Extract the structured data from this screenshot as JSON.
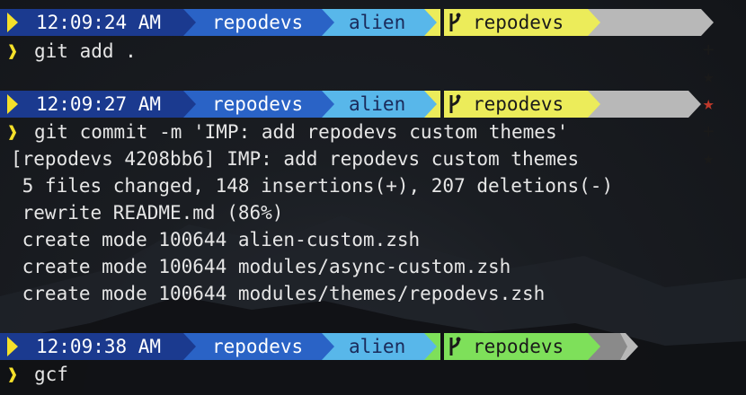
{
  "colors": {
    "time_bg": "#1b3a8f",
    "time_fg": "#ffffff",
    "user_bg": "#2a63c6",
    "user_fg": "#ffffff",
    "dir_bg": "#58b7ea",
    "dir_fg": "#1a2a5a",
    "branch_bg": "#ecec5a",
    "branch_bg_clean": "#7ee05a",
    "branch_fg": "#1a1a1a",
    "status_bg": "#b8b8b8",
    "status_fg": "#1a1a1a",
    "stash_star": "#c0392b",
    "prompt_arrow": "#f5e02a"
  },
  "prompts": [
    {
      "time": "12:09:24 AM",
      "user": "repodevs",
      "dir": "alien",
      "branch_icon": "git-branch-icon",
      "branch": "repodevs",
      "status": [
        "+",
        "★",
        "★"
      ],
      "command": "git add ."
    },
    {
      "time": "12:09:27 AM",
      "user": "repodevs",
      "dir": "alien",
      "branch_icon": "git-branch-icon",
      "branch": "repodevs",
      "status": [
        "+",
        "★"
      ],
      "command": "git commit -m 'IMP: add repodevs custom themes'"
    },
    {
      "time": "12:09:38 AM",
      "user": "repodevs",
      "dir": "alien",
      "branch_icon": "git-branch-icon",
      "branch": "repodevs",
      "status": [],
      "command": "gcf"
    }
  ],
  "output_lines": [
    "[repodevs 4208bb6] IMP: add repodevs custom themes",
    " 5 files changed, 148 insertions(+), 207 deletions(-)",
    " rewrite README.md (86%)",
    " create mode 100644 alien-custom.zsh",
    " create mode 100644 modules/async-custom.zsh",
    " create mode 100644 modules/themes/repodevs.zsh"
  ]
}
